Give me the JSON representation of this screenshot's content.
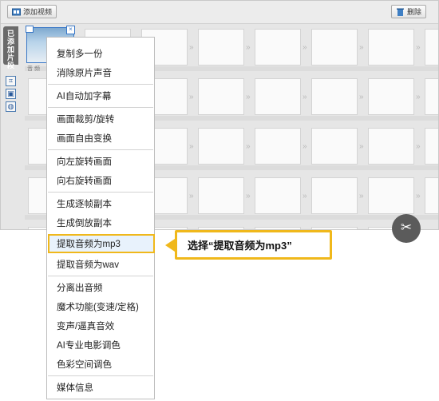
{
  "toolbar": {
    "add_video_label": "添加视频",
    "delete_label": "删除"
  },
  "sidebar": {
    "tab_label_chars": [
      "已",
      "添",
      "加",
      "片",
      "段"
    ]
  },
  "clip": {
    "audio_label": "音 频"
  },
  "context_menu": {
    "items": [
      "复制多一份",
      "消除原片声音",
      "AI自动加字幕",
      "画面裁剪/旋转",
      "画面自由变换",
      "向左旋转画面",
      "向右旋转画面",
      "生成逐帧副本",
      "生成倒放副本",
      "提取音频为mp3",
      "提取音频为wav",
      "分离出音频",
      "魔术功能(变速/定格)",
      "变声/逼真音效",
      "AI专业电影调色",
      "色彩空间调色",
      "媒体信息"
    ],
    "highlighted": "提取音频为mp3"
  },
  "callout": {
    "text": "选择“提取音频为mp3”"
  },
  "colors": {
    "highlight_border": "#f0b81b",
    "selection_blue": "#3a78c7"
  },
  "icons": {
    "add_video": "film-icon",
    "delete": "trash-icon",
    "crop": "crop-icon",
    "image": "image-icon",
    "color": "palette-icon",
    "scissors": "scissors-icon",
    "arrow": "double-chevron-right-icon"
  }
}
